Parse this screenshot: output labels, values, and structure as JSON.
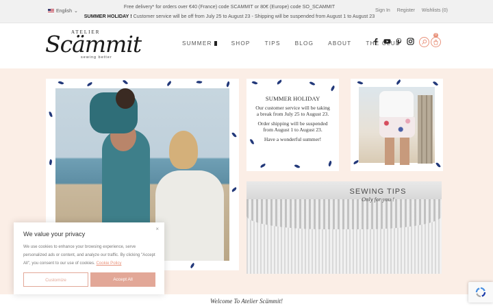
{
  "topbar": {
    "language": "English",
    "promo_line1": "Free delivery* for orders over €40 (France) code SCAMMIT or 80€ (Europe) code SO_SCAMMIT",
    "promo_bold": "SUMMER HOLIDAY !",
    "promo_line2": " Customer service will be off from July 25 to August 23 - Shipping will be suspended from August 1 to August 23",
    "sign_in": "Sign In",
    "register": "Register",
    "wishlists": "Wishlists (0)"
  },
  "header": {
    "logo_atelier": "ATELIER",
    "logo_main": "Scämmit",
    "logo_tagline": "sewing better",
    "nav": [
      "SUMMER",
      "SHOP",
      "TIPS",
      "BLOG",
      "ABOUT",
      "THE CLUB"
    ],
    "social_icons": [
      "facebook-icon",
      "youtube-icon",
      "pinterest-icon",
      "instagram-icon"
    ],
    "cart_count": "0"
  },
  "holiday": {
    "title": "SUMMER HOLIDAY",
    "p1": "Our customer service will be taking a break from July 25 to August 23.",
    "p2": "Order shipping will be suspended from August 1 to August 23.",
    "p3": "Have a wonderful summer!"
  },
  "sewing": {
    "title": "SEWING TIPS",
    "subtitle": "Only for you !"
  },
  "welcome": "Welcome To Atelier Scämmit!",
  "cookie": {
    "title": "We value your privacy",
    "body": "We use cookies to enhance your browsing experience, serve personalized ads or content, and analyze our traffic. By clicking \"Accept All\", you consent to our use of cookies.",
    "link": "Cookie Policy",
    "customize": "Customize",
    "accept": "Accept All",
    "close": "×"
  },
  "colors": {
    "accent": "#e2a797",
    "leaf": "#23397a",
    "main_bg": "#fbeee6"
  }
}
